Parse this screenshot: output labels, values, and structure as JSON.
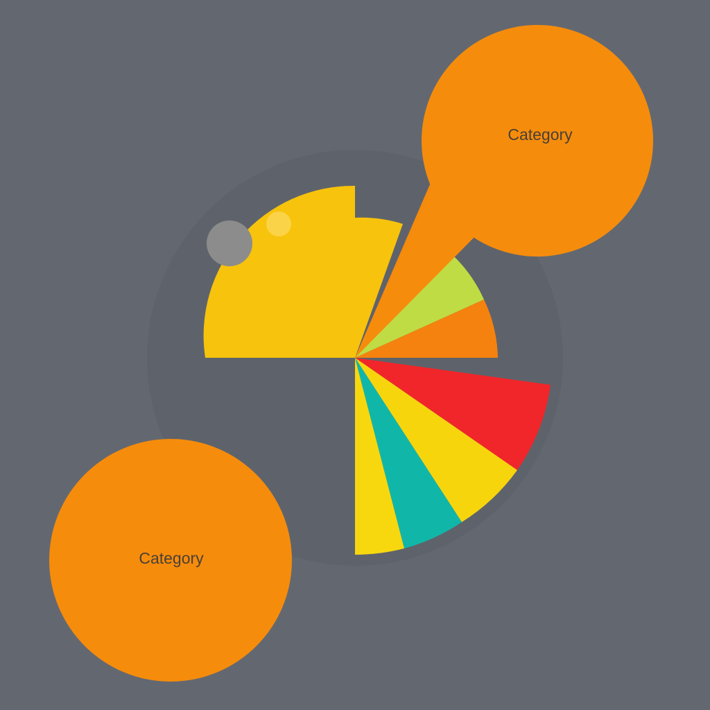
{
  "chart_data": {
    "type": "pie",
    "title": "",
    "slices": [
      {
        "value": 40,
        "color": "#f7c30c"
      },
      {
        "value": 3,
        "color": "#f58a0c"
      },
      {
        "value": 4,
        "color": "#bfdc44"
      },
      {
        "value": 3,
        "color": "#f5820e"
      },
      {
        "value": 14,
        "color": "#f1262a"
      },
      {
        "value": 8,
        "color": "#f7d50d"
      },
      {
        "value": 6,
        "color": "#10b7a9"
      },
      {
        "value": 3,
        "color": "#f7d80f"
      }
    ],
    "callouts": [
      {
        "label": "Category",
        "color": "#f68c0c"
      },
      {
        "label": "Category",
        "color": "#f68c0c"
      }
    ]
  },
  "colors": {
    "background": "#636870",
    "halo": "#5e636b",
    "knob": "#8c8c8c",
    "highlight": "#fbd654"
  }
}
